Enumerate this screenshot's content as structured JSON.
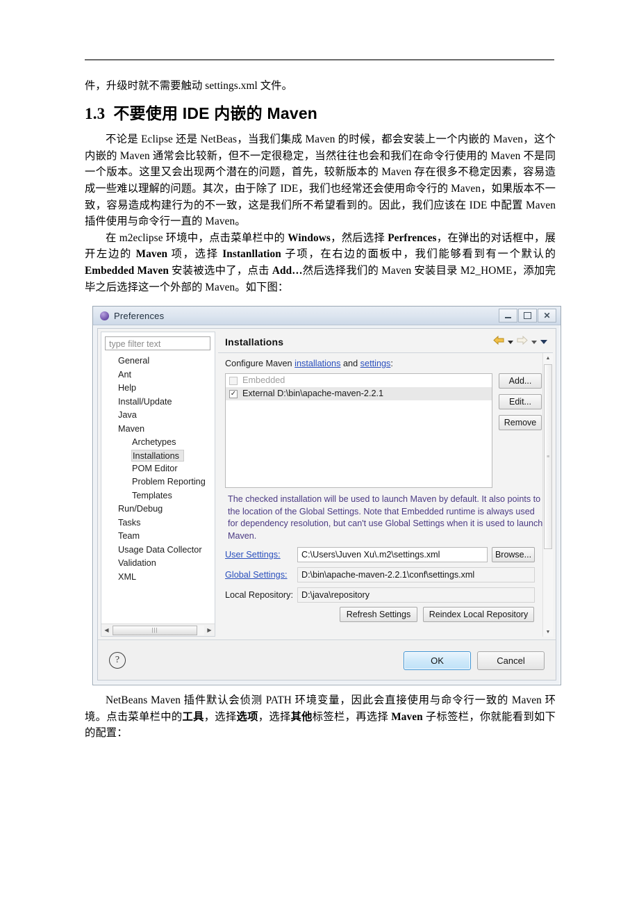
{
  "document": {
    "paragraphs": {
      "p1": "件，升级时就不需要触动 settings.xml 文件。",
      "p2": "不论是 Eclipse 还是 NetBeas，当我们集成 Maven 的时候，都会安装上一个内嵌的 Maven，这个内嵌的 Maven 通常会比较新，但不一定很稳定，当然往往也会和我们在命令行使用的 Maven 不是同一个版本。这里又会出现两个潜在的问题，首先，较新版本的 Maven 存在很多不稳定因素，容易造成一些难以理解的问题。其次，由于除了 IDE，我们也经常还会使用命令行的 Maven，如果版本不一致，容易造成构建行为的不一致，这是我们所不希望看到的。因此，我们应该在 IDE 中配置 Maven 插件使用与命令行一直的 Maven。",
      "p4": "NetBeans Maven 插件默认会侦测 PATH 环境变量，因此会直接使用与命令行一致的 Maven 环境。点击菜单栏中的"
    },
    "heading": {
      "number": "1.3",
      "text": "不要使用 IDE 内嵌的 Maven"
    },
    "p3_parts": {
      "s1": "在 m2eclipse 环境中，点击菜单栏中的 ",
      "b1": "Windows",
      "s2": "，然后选择 ",
      "b2": "Perfrences",
      "s3": "，在弹出的对话框中，展开左边的 ",
      "b3": "Maven",
      "s4": " 项，选择 ",
      "b4": "Instanllation",
      "s5": " 子项，在右边的面板中，我们能够看到有一个默认的 ",
      "b5": "Embedded Maven",
      "s6": " 安装被选中了，点击 ",
      "b6": "Add…",
      "s7": "然后选择我们的 Maven 安装目录 M2_HOME，添加完毕之后选择这一个外部的 Maven。如下图："
    },
    "p4_parts": {
      "b1": "工具",
      "s2": "，选择",
      "b2": "选项",
      "s3": "，选择",
      "b3": "其他",
      "s4": "标签栏，再选择 ",
      "b4": "Maven",
      "s5": " 子标签栏，你就能看到如下的配置："
    }
  },
  "dialog": {
    "title": "Preferences",
    "window_buttons": {
      "minimize": "–",
      "maximize": "□",
      "close": "✕"
    },
    "filter_placeholder": "type filter text",
    "tree": [
      {
        "label": "General",
        "level": 1,
        "selected": false
      },
      {
        "label": "Ant",
        "level": 1,
        "selected": false
      },
      {
        "label": "Help",
        "level": 1,
        "selected": false
      },
      {
        "label": "Install/Update",
        "level": 1,
        "selected": false
      },
      {
        "label": "Java",
        "level": 1,
        "selected": false
      },
      {
        "label": "Maven",
        "level": 1,
        "selected": false
      },
      {
        "label": "Archetypes",
        "level": 2,
        "selected": false
      },
      {
        "label": "Installations",
        "level": 2,
        "selected": true
      },
      {
        "label": "POM Editor",
        "level": 2,
        "selected": false
      },
      {
        "label": "Problem Reporting",
        "level": 2,
        "selected": false
      },
      {
        "label": "Templates",
        "level": 2,
        "selected": false
      },
      {
        "label": "Run/Debug",
        "level": 1,
        "selected": false
      },
      {
        "label": "Tasks",
        "level": 1,
        "selected": false
      },
      {
        "label": "Team",
        "level": 1,
        "selected": false
      },
      {
        "label": "Usage Data Collector",
        "level": 1,
        "selected": false
      },
      {
        "label": "Validation",
        "level": 1,
        "selected": false
      },
      {
        "label": "XML",
        "level": 1,
        "selected": false
      }
    ],
    "panel": {
      "title": "Installations",
      "configure": {
        "prefix": "Configure Maven ",
        "link1": "installations",
        "mid": " and ",
        "link2": "settings",
        "suffix": ":"
      },
      "installations": [
        {
          "label": "Embedded",
          "checked": false,
          "enabled": false,
          "selected": false
        },
        {
          "label": "External D:\\bin\\apache-maven-2.2.1",
          "checked": true,
          "enabled": true,
          "selected": true
        }
      ],
      "buttons": {
        "add": "Add...",
        "edit": "Edit...",
        "remove": "Remove"
      },
      "note": "The checked installation will be used to launch Maven by default. It also points to the location of the Global Settings. Note that Embedded runtime is always used for dependency resolution, but can't use Global Settings when it is used to launch Maven.",
      "settings_rows": [
        {
          "label": "User Settings:",
          "value": "C:\\Users\\Juven Xu\\.m2\\settings.xml",
          "link": true,
          "readonly": false,
          "browse": "Browse..."
        },
        {
          "label": "Global Settings:",
          "value": "D:\\bin\\apache-maven-2.2.1\\conf\\settings.xml",
          "link": true,
          "readonly": true,
          "browse": ""
        },
        {
          "label": "Local Repository:",
          "value": "D:\\java\\repository",
          "link": false,
          "readonly": true,
          "browse": ""
        }
      ],
      "action_buttons": {
        "refresh": "Refresh Settings",
        "reindex": "Reindex Local Repository"
      }
    },
    "footer": {
      "help": "?",
      "ok": "OK",
      "cancel": "Cancel"
    },
    "colors": {
      "link": "#2a4fbd",
      "note_text": "#4b3a83",
      "ok_border": "#3c93d4",
      "selection": "#e8e8e8"
    }
  }
}
